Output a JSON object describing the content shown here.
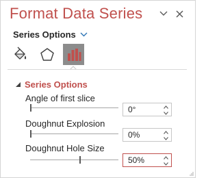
{
  "pane": {
    "title": "Format Data Series",
    "collapse_icon": "chevron-down-icon",
    "close_icon": "close-icon",
    "accent_color": "#c0504d"
  },
  "options_menu": {
    "label": "Series Options",
    "icon": "chevron-down-icon"
  },
  "tabs": [
    {
      "name": "Fill & Line",
      "icon": "paint-bucket-icon",
      "active": false
    },
    {
      "name": "Effects",
      "icon": "pentagon-icon",
      "active": false
    },
    {
      "name": "Series Options",
      "icon": "bar-chart-icon",
      "active": true
    }
  ],
  "section": {
    "label": "Series Options",
    "expanded": true,
    "fields": [
      {
        "label": "Angle of first slice",
        "value": "0°",
        "slider_fraction": 0
      },
      {
        "label": "Doughnut Explosion",
        "value": "0%",
        "slider_fraction": 0
      },
      {
        "label": "Doughnut Hole Size",
        "value": "50%",
        "slider_fraction": 0.5
      }
    ]
  }
}
